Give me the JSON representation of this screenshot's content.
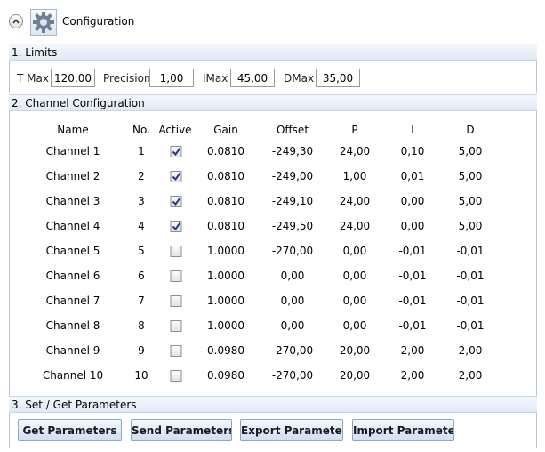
{
  "header": {
    "title": "Configuration"
  },
  "limits": {
    "section_title": "1. Limits",
    "fields": [
      {
        "label": "T Max",
        "value": "120,00"
      },
      {
        "label": "Precision",
        "value": "1,00"
      },
      {
        "label": "IMax",
        "value": "45,00"
      },
      {
        "label": "DMax",
        "value": "35,00"
      }
    ]
  },
  "channels": {
    "section_title": "2. Channel Configuration",
    "headers": {
      "name": "Name",
      "no": "No.",
      "active": "Active",
      "gain": "Gain",
      "offset": "Offset",
      "p": "P",
      "i": "I",
      "d": "D"
    },
    "rows": [
      {
        "name": "Channel 1",
        "no": "1",
        "active": true,
        "gain": "0.0810",
        "offset": "-249,30",
        "p": "24,00",
        "i": "0,10",
        "d": "5,00"
      },
      {
        "name": "Channel 2",
        "no": "2",
        "active": true,
        "gain": "0.0810",
        "offset": "-249,00",
        "p": "1,00",
        "i": "0,01",
        "d": "5,00"
      },
      {
        "name": "Channel 3",
        "no": "3",
        "active": true,
        "gain": "0.0810",
        "offset": "-249,10",
        "p": "24,00",
        "i": "0,00",
        "d": "5,00"
      },
      {
        "name": "Channel 4",
        "no": "4",
        "active": true,
        "gain": "0.0810",
        "offset": "-249,50",
        "p": "24,00",
        "i": "0,00",
        "d": "5,00"
      },
      {
        "name": "Channel 5",
        "no": "5",
        "active": false,
        "gain": "1.0000",
        "offset": "-270,00",
        "p": "0,00",
        "i": "-0,01",
        "d": "-0,01"
      },
      {
        "name": "Channel 6",
        "no": "6",
        "active": false,
        "gain": "1.0000",
        "offset": "0,00",
        "p": "0,00",
        "i": "-0,01",
        "d": "-0,01"
      },
      {
        "name": "Channel 7",
        "no": "7",
        "active": false,
        "gain": "1.0000",
        "offset": "0,00",
        "p": "0,00",
        "i": "-0,01",
        "d": "-0,01"
      },
      {
        "name": "Channel 8",
        "no": "8",
        "active": false,
        "gain": "1.0000",
        "offset": "0,00",
        "p": "0,00",
        "i": "-0,01",
        "d": "-0,01"
      },
      {
        "name": "Channel 9",
        "no": "9",
        "active": false,
        "gain": "0.0980",
        "offset": "-270,00",
        "p": "20,00",
        "i": "2,00",
        "d": "2,00"
      },
      {
        "name": "Channel 10",
        "no": "10",
        "active": false,
        "gain": "0.0980",
        "offset": "-270,00",
        "p": "20,00",
        "i": "2,00",
        "d": "2,00"
      }
    ]
  },
  "params": {
    "section_title": "3. Set / Get Parameters",
    "buttons": [
      "Get Parameters",
      "Send Parameters",
      "Export Parameter",
      "Import Parameter"
    ]
  },
  "icons": {
    "collapse": "chevron-up-icon",
    "config": "gear-icon",
    "check": "check-icon"
  },
  "colors": {
    "section_bg": "#e6eef8",
    "button_bg": "#d9e6f6",
    "border": "#b8c8dc"
  }
}
